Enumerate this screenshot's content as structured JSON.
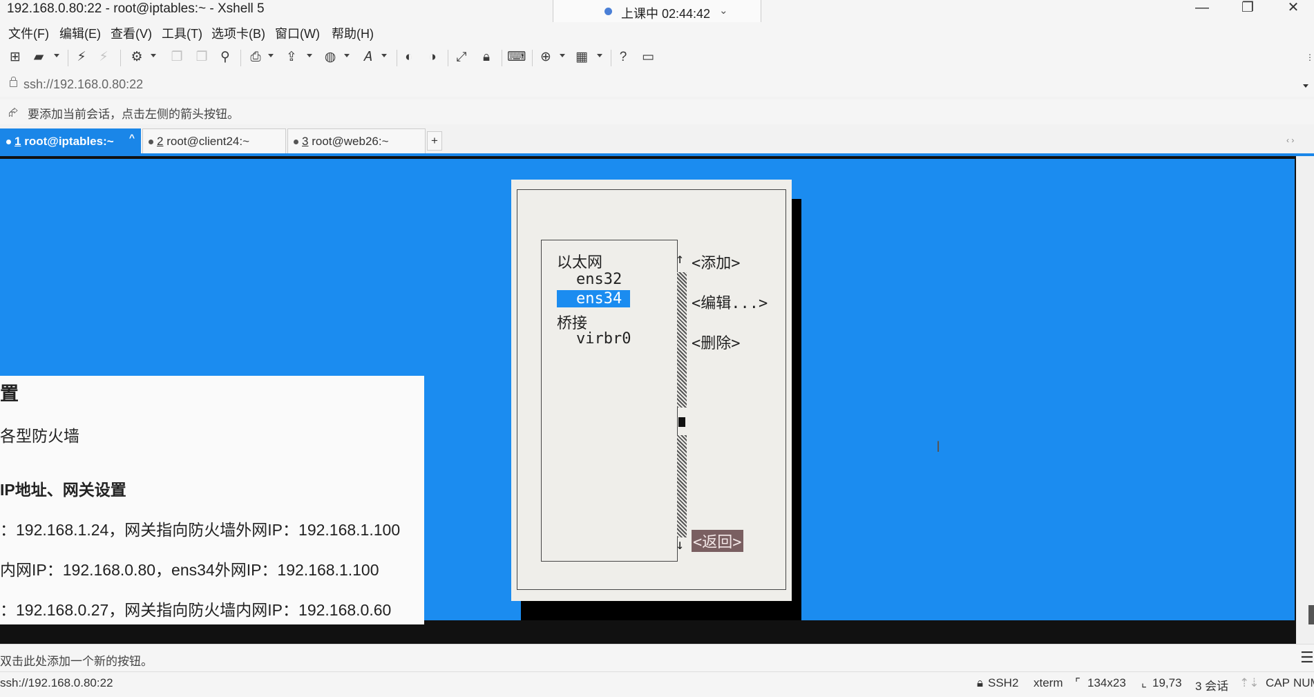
{
  "window": {
    "title": "192.168.0.80:22 - root@iptables:~ - Xshell 5",
    "controls": {
      "minimize": "—",
      "maximize": "❐",
      "close": "✕"
    }
  },
  "class_timer": {
    "text": "上课中 02:44:42",
    "chevron": "⌄"
  },
  "menu": [
    "文件(F)",
    "编辑(E)",
    "查看(V)",
    "工具(T)",
    "选项卡(B)",
    "窗口(W)",
    "帮助(H)"
  ],
  "address": {
    "value": "ssh://192.168.0.80:22"
  },
  "session_hint": {
    "icon": "session-arrow-icon",
    "text": "要添加当前会话，点击左侧的箭头按钮。"
  },
  "tabs": [
    {
      "num": "1",
      "label": "root@iptables:~",
      "active": true,
      "close": "^"
    },
    {
      "num": "2",
      "label": "root@client24:~",
      "active": false
    },
    {
      "num": "3",
      "label": "root@web26:~",
      "active": false
    }
  ],
  "tab_add": "+",
  "tab_nav": "‹ ›",
  "terminal": {
    "cursor": "I",
    "nmtui": {
      "connections": [
        {
          "text": "以太网",
          "type": "group"
        },
        {
          "text": "ens32",
          "type": "item"
        },
        {
          "text": "ens34",
          "type": "item",
          "selected": true
        },
        {
          "text": "桥接",
          "type": "group"
        },
        {
          "text": "virbr0",
          "type": "item"
        }
      ],
      "scroll_up": "↑",
      "scroll_down": "↓",
      "buttons": {
        "add": "<添加>",
        "edit": "<编辑...>",
        "delete": "<删除>",
        "back": "<返回>"
      }
    }
  },
  "slide": {
    "heading": "置",
    "line1": "各型防火墙",
    "subheading": "IP地址、网关设置",
    "line2": "：192.168.1.24，网关指向防火墙外网IP：192.168.1.100",
    "line3": "内网IP：192.168.0.80，ens34外网IP：192.168.1.100",
    "line4": "：192.168.0.27，网关指向防火墙内网IP：192.168.0.60"
  },
  "quick_command": {
    "text": "双击此处添加一个新的按钮。",
    "menu_icon": "☰"
  },
  "status": {
    "connection": "ssh://192.168.0.80:22",
    "protocol": "SSH2",
    "terminal_type": "xterm",
    "size": "134x23",
    "cursor_pos": "19,73",
    "sessions": "3 会话",
    "caps": "CAP",
    "num": "NUM"
  },
  "toolbar_icons": [
    "new-session-icon",
    "open-folder-icon",
    "reconnect-icon",
    "disconnect-icon",
    "properties-icon",
    "copy-icon",
    "paste-icon",
    "find-icon",
    "print-icon",
    "transfer-icon",
    "globe-icon",
    "font-icon",
    "xftp-icon",
    "xmanager-icon",
    "fullscreen-icon",
    "lock-icon",
    "keyboard-icon",
    "add-icon",
    "layout-icon",
    "help-icon",
    "chat-icon"
  ]
}
